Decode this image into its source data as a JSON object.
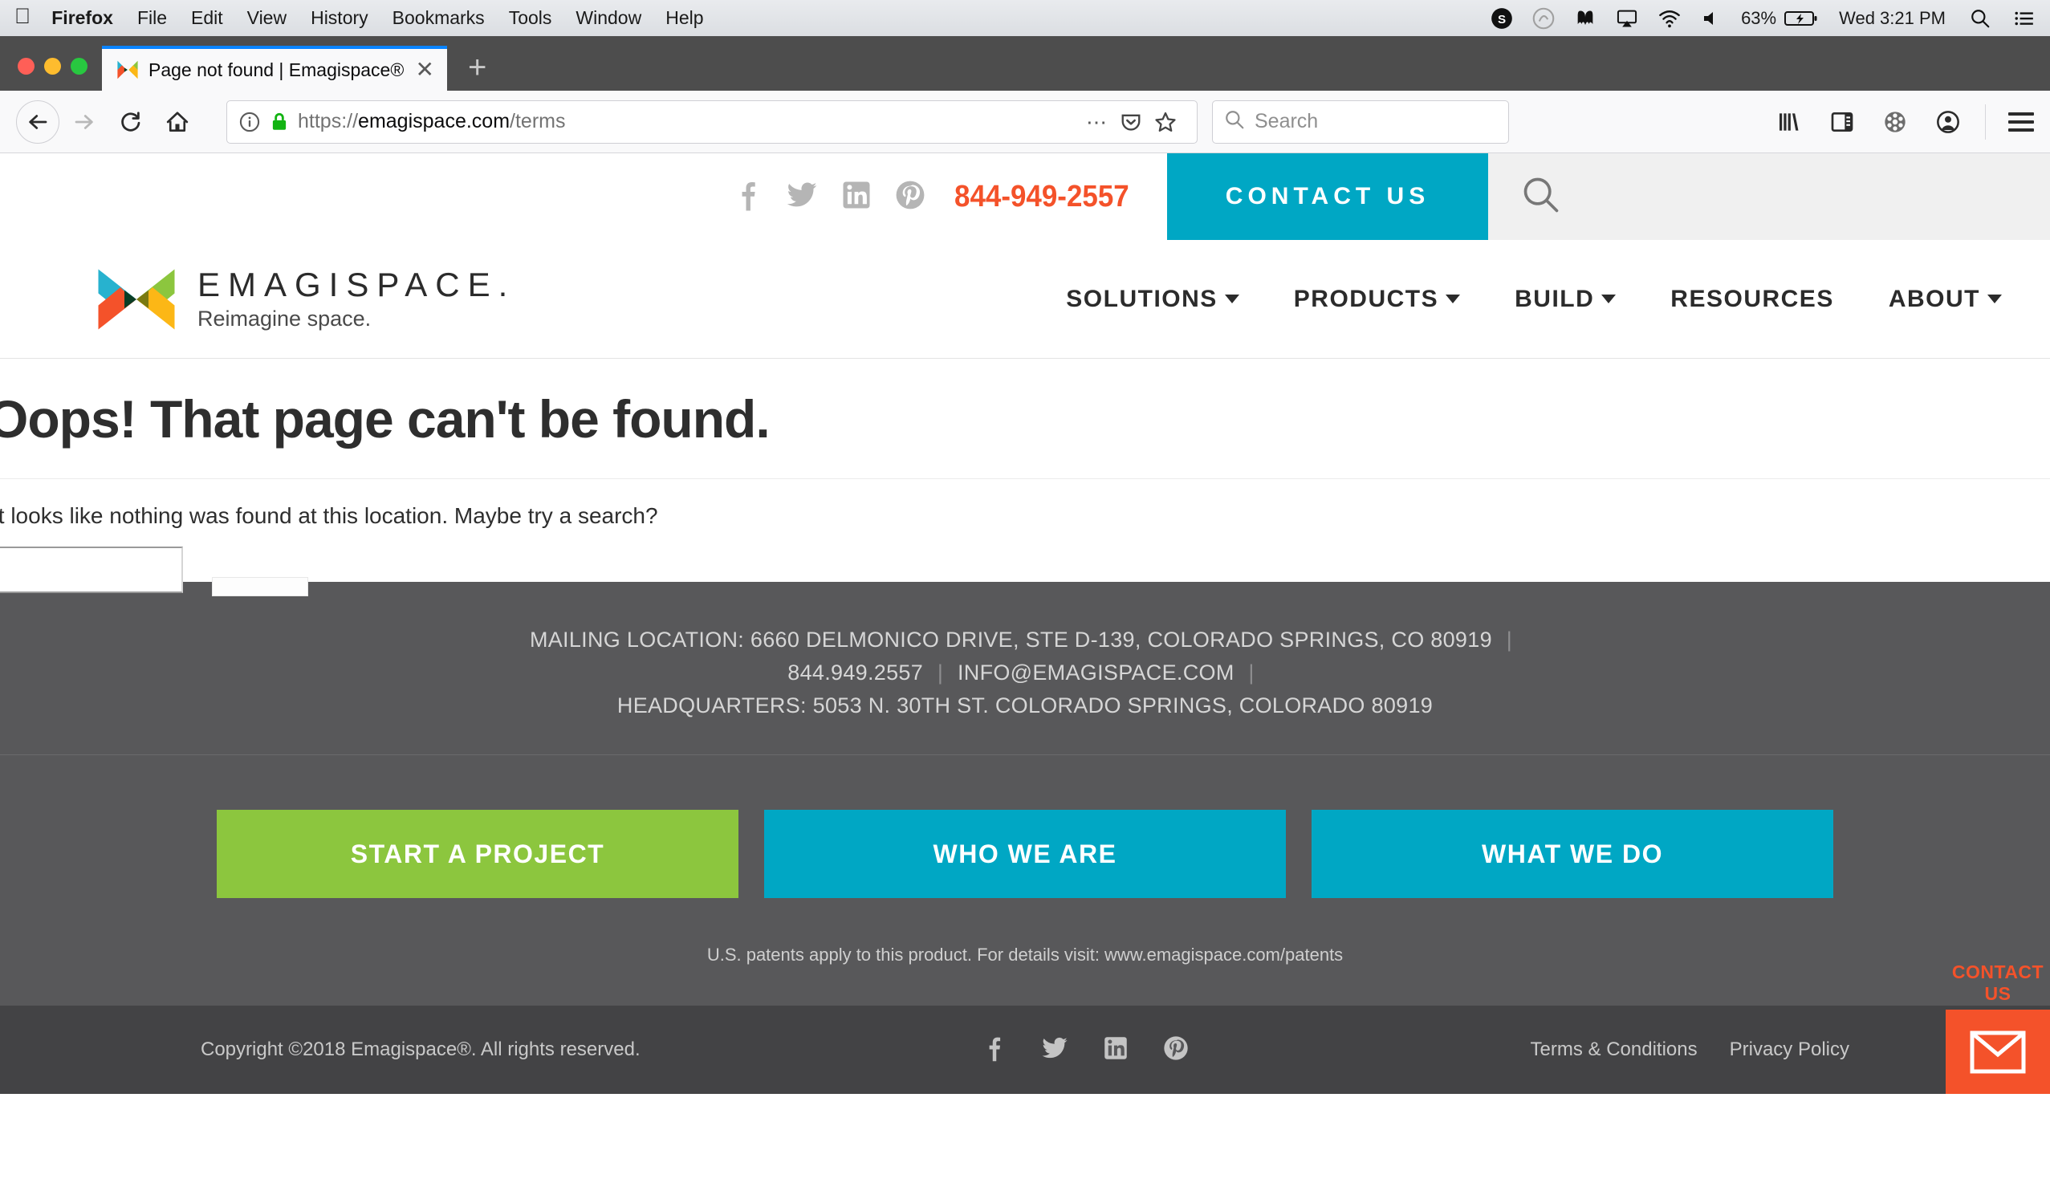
{
  "os_menu": {
    "apple_icon": "apple-icon",
    "items": [
      "Firefox",
      "File",
      "Edit",
      "View",
      "History",
      "Bookmarks",
      "Tools",
      "Window",
      "Help"
    ],
    "status_icons": [
      "skype-icon",
      "creative-cloud-icon",
      "malwarebytes-icon",
      "airplay-icon",
      "wifi-icon",
      "volume-icon"
    ],
    "battery": "63%",
    "battery_icon": "battery-charging-icon",
    "clock": "Wed 3:21 PM",
    "spotlight_icon": "search-icon",
    "notification_icon": "list-icon"
  },
  "browser": {
    "tab": {
      "title": "Page not found | Emagispace®",
      "favicon": "emagispace-favicon",
      "close_icon": "close-icon"
    },
    "new_tab_label": "+",
    "nav": {
      "back_icon": "arrow-left-icon",
      "forward_icon": "arrow-right-icon",
      "reload_icon": "reload-icon",
      "home_icon": "home-icon"
    },
    "url_bar": {
      "info_icon": "info-icon",
      "lock_icon": "lock-icon",
      "url_scheme": "https://",
      "url_host": "emagispace.com",
      "url_path": "/terms",
      "page_actions_icon": "ellipsis-icon",
      "pocket_icon": "pocket-icon",
      "bookmark_icon": "star-icon"
    },
    "search": {
      "placeholder": "Search",
      "icon": "search-icon"
    },
    "toolbar_icons": [
      "library-icon",
      "sidebar-icon",
      "film-icon",
      "account-icon",
      "menu-icon"
    ]
  },
  "site": {
    "top_strip": {
      "social": [
        "facebook-icon",
        "twitter-icon",
        "linkedin-icon",
        "pinterest-icon"
      ],
      "phone": "844-949-2557",
      "contact_label": "CONTACT US",
      "search_icon": "search-icon"
    },
    "logo": {
      "name": "EMAGISPACE.",
      "tagline": "Reimagine space.",
      "mark": "emagispace-x-logo"
    },
    "nav": [
      {
        "label": "SOLUTIONS",
        "has_caret": true
      },
      {
        "label": "PRODUCTS",
        "has_caret": true
      },
      {
        "label": "BUILD",
        "has_caret": true
      },
      {
        "label": "RESOURCES",
        "has_caret": false
      },
      {
        "label": "ABOUT",
        "has_caret": true
      }
    ]
  },
  "page": {
    "title": "Oops! That page can't be found.",
    "body_text": "It looks like nothing was found at this location. Maybe try a search?",
    "search_value": "",
    "search_button_label": ""
  },
  "footer": {
    "address_line1": "MAILING LOCATION: 6660 DELMONICO DRIVE, STE D-139, COLORADO SPRINGS, CO 80919",
    "phone": "844.949.2557",
    "email": "INFO@EMAGISPACE.COM",
    "address_line3": "HEADQUARTERS: 5053 N. 30TH ST. COLORADO SPRINGS, COLORADO 80919",
    "ctas": [
      {
        "label": "START A PROJECT",
        "color": "#8cc63e"
      },
      {
        "label": "WHO WE ARE",
        "color": "#00a7c4"
      },
      {
        "label": "WHAT WE DO",
        "color": "#00a7c4"
      }
    ],
    "patents": "U.S. patents apply to this product. For details visit: www.emagispace.com/patents",
    "copyright": "Copyright ©2018 Emagispace®. All rights reserved.",
    "social": [
      "facebook-icon",
      "twitter-icon",
      "linkedin-icon",
      "pinterest-icon"
    ],
    "links": [
      "Terms & Conditions",
      "Privacy Policy"
    ]
  },
  "sticky_widget": {
    "label": "CONTACT US",
    "icon": "envelope-icon",
    "color": "#f4522a"
  },
  "colors": {
    "accent_cyan": "#00a7c4",
    "accent_orange": "#f4522a",
    "accent_green": "#8cc63e",
    "footer_grey": "#58585a"
  }
}
